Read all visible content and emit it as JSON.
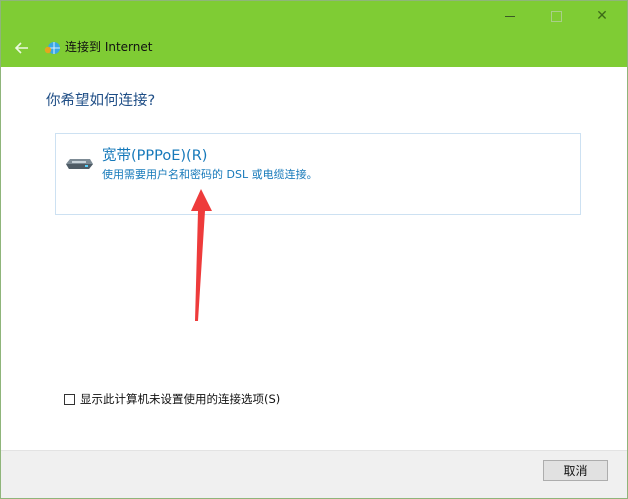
{
  "window": {
    "title": "连接到 Internet",
    "controls": {
      "minimize_icon": "minimize-icon",
      "maximize_icon": "maximize-icon",
      "close_label": "✕"
    }
  },
  "prompt": "你希望如何连接?",
  "option": {
    "title": "宽带(PPPoE)(R)",
    "description": "使用需要用户名和密码的 DSL 或电缆连接。",
    "icon": "broadband-modem-icon"
  },
  "annotation": {
    "arrow_icon": "red-arrow-icon",
    "color": "#ee3b3b"
  },
  "checkbox": {
    "checked": false,
    "label": "显示此计算机未设置使用的连接选项(S)"
  },
  "footer": {
    "cancel_label": "取消"
  },
  "colors": {
    "titlebar": "#7fcc34",
    "prompt_text": "#1f4e86",
    "option_text": "#1679ba",
    "option_border": "#cde1f2"
  }
}
